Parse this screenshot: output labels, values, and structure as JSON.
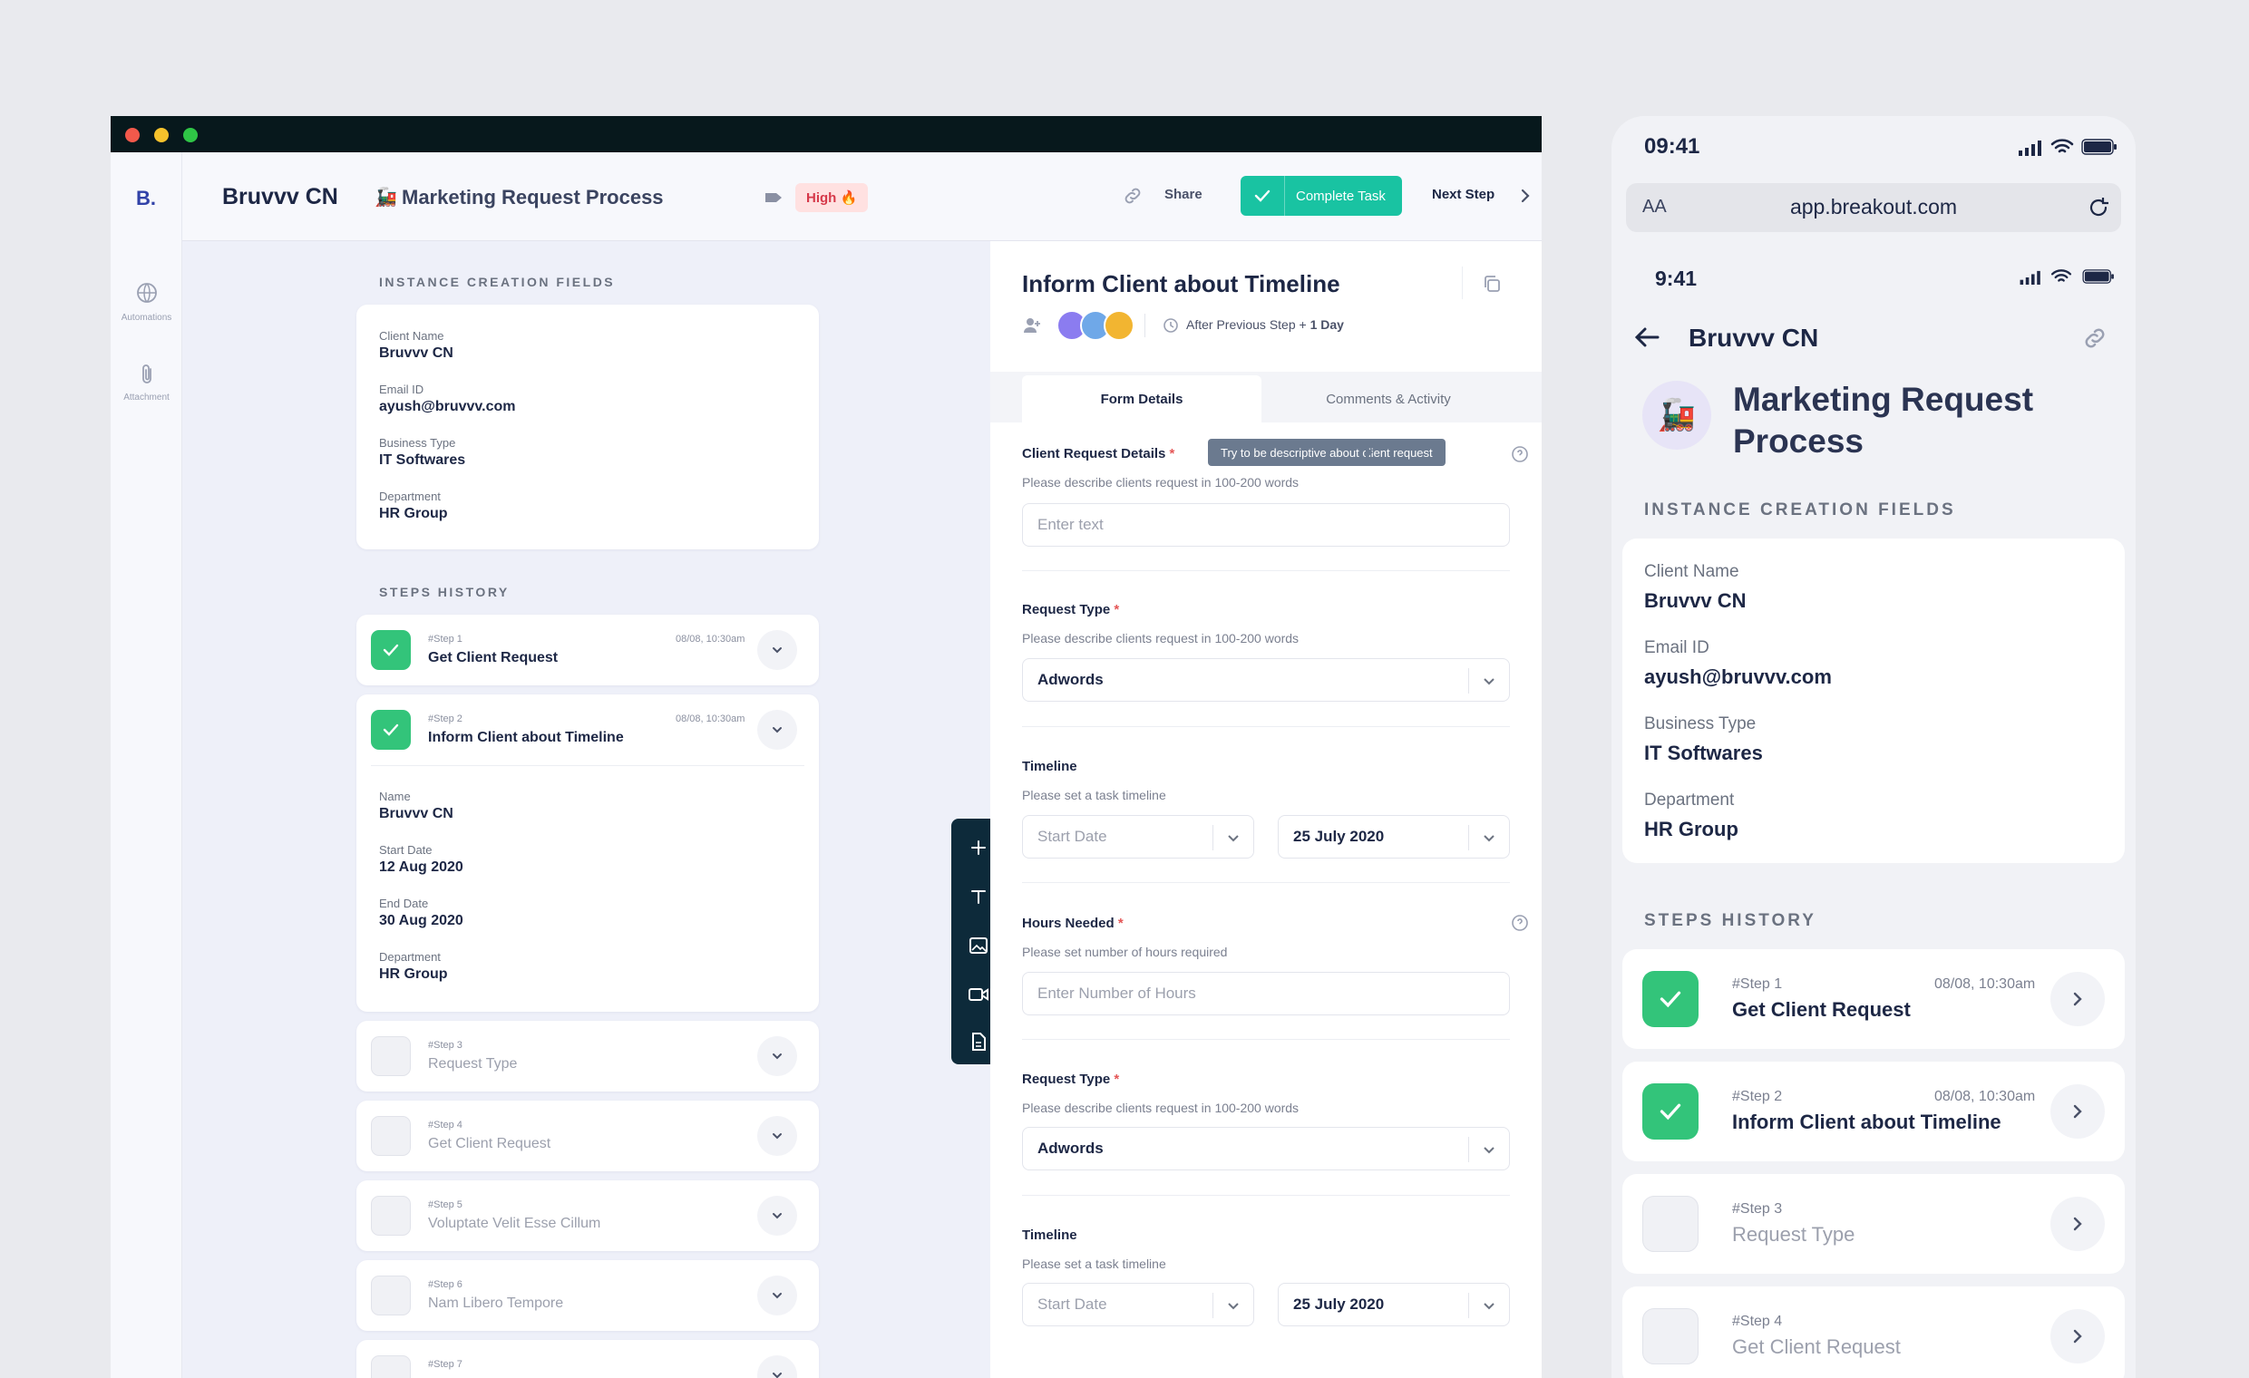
{
  "app": {
    "logo": "B.",
    "workspace": "Bruvvv CN",
    "process_title": "Marketing Request Process",
    "process_emoji": "🚂",
    "priority": "High 🔥",
    "share_label": "Share",
    "complete_label": "Complete Task",
    "next_step_label": "Next Step"
  },
  "sidebar": {
    "items": [
      {
        "label": "Automations",
        "icon": "globe-icon"
      },
      {
        "label": "Attachment",
        "icon": "paperclip-icon"
      }
    ]
  },
  "instance": {
    "heading": "INSTANCE CREATION FIELDS",
    "fields": [
      {
        "label": "Client Name",
        "value": "Bruvvv CN"
      },
      {
        "label": "Email ID",
        "value": "ayush@bruvvv.com"
      },
      {
        "label": "Business Type",
        "value": "IT Softwares"
      },
      {
        "label": "Department",
        "value": "HR Group"
      }
    ]
  },
  "steps": {
    "heading": "STEPS HISTORY",
    "items": [
      {
        "no": "#Step 1",
        "title": "Get Client Request",
        "date": "08/08, 10:30am",
        "done": true
      },
      {
        "no": "#Step 2",
        "title": "Inform Client about Timeline",
        "date": "08/08, 10:30am",
        "done": true
      },
      {
        "no": "#Step 3",
        "title": "Request Type",
        "done": false
      },
      {
        "no": "#Step 4",
        "title": "Get Client Request",
        "done": false
      },
      {
        "no": "#Step 5",
        "title": "Voluptate Velit Esse Cillum",
        "done": false
      },
      {
        "no": "#Step 6",
        "title": "Nam Libero Tempore",
        "done": false
      },
      {
        "no": "#Step 7",
        "title": "",
        "done": false
      }
    ],
    "expanded": [
      {
        "label": "Name",
        "value": "Bruvvv CN"
      },
      {
        "label": "Start Date",
        "value": "12 Aug 2020"
      },
      {
        "label": "End Date",
        "value": "30 Aug 2020"
      },
      {
        "label": "Department",
        "value": "HR Group"
      }
    ]
  },
  "task": {
    "title": "Inform Client about Timeline",
    "schedule": "After Previous Step + ",
    "schedule_bold": "1 Day",
    "tabs": [
      "Form Details",
      "Comments & Activity"
    ],
    "tooltip": "Try to be descriptive about client request",
    "fields": [
      {
        "label": "Client Request Details",
        "help": "Please describe clients request in 100-200 words",
        "placeholder": "Enter text"
      },
      {
        "label": "Request Type",
        "help": "Please describe clients request in 100-200 words",
        "value": "Adwords"
      },
      {
        "label": "Timeline",
        "help": "Please set a task timeline",
        "start_placeholder": "Start Date",
        "end_value": "25 July 2020"
      },
      {
        "label": "Hours Needed",
        "help": "Please set number of hours required",
        "placeholder": "Enter Number of Hours"
      },
      {
        "label": "Request Type",
        "help": "Please describe clients request in 100-200 words",
        "value": "Adwords"
      },
      {
        "label": "Timeline",
        "help": "Please set a task timeline",
        "start_placeholder": "Start Date",
        "end_value": "25 July 2020"
      }
    ]
  },
  "mobile": {
    "time_outer": "09:41",
    "url_aa": "AA",
    "url": "app.breakout.com",
    "time_inner": "9:41",
    "back_title": "Bruvvv CN",
    "process_title_line1": "Marketing Request",
    "process_title_line2": "Process"
  },
  "colors": {
    "accent": "#19c3a2",
    "success": "#33c47a",
    "priority_bg": "#ffe1e1",
    "priority_text": "#d6394a",
    "toolbar_bg": "#0d2a3a"
  }
}
